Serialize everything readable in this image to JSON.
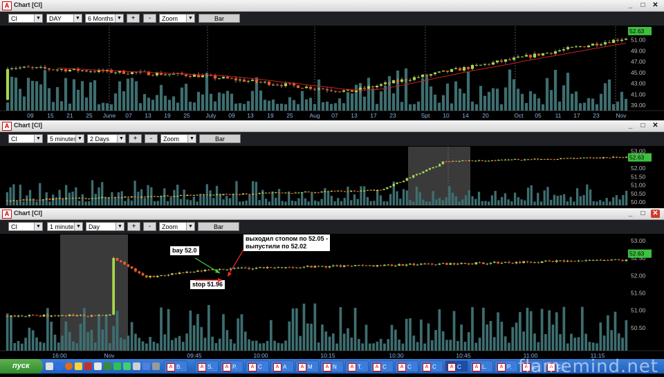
{
  "windows": [
    {
      "title": "Chart [CI]",
      "symbol": "CI",
      "period": "DAY",
      "range": "6 Months",
      "zoom": "Zoom",
      "plus": "+",
      "minus": "-",
      "bar": "Bar",
      "x_labels": [
        "09",
        "15",
        "21",
        "25",
        "June",
        "07",
        "13",
        "19",
        "25",
        "July",
        "09",
        "13",
        "19",
        "25",
        "Aug",
        "07",
        "13",
        "17",
        "23",
        "Spt",
        "10",
        "14",
        "20",
        "Oct",
        "05",
        "11",
        "17",
        "23",
        "Nov"
      ],
      "y_labels": [
        "51.00",
        "49.00",
        "47.00",
        "45.00",
        "43.00",
        "41.00",
        "39.00"
      ],
      "last_price": "52.63",
      "chart_data": {
        "type": "candlestick",
        "y_range": [
          38,
          53
        ],
        "start": 40.0,
        "end": 52.63,
        "ma_color": "#cc2020"
      }
    },
    {
      "title": "Chart [CI]",
      "symbol": "CI",
      "period": "5 minutes",
      "range": "2 Days",
      "zoom": "Zoom",
      "plus": "+",
      "minus": "-",
      "bar": "Bar",
      "y_labels": [
        "53.00",
        "52.50",
        "52.00",
        "51.50",
        "51.00",
        "50.50",
        "50.00"
      ],
      "last_price": "52.63",
      "chart_data": {
        "type": "candlestick",
        "y_range": [
          49.8,
          53.1
        ],
        "start": 50.1,
        "end": 52.63
      }
    },
    {
      "title": "Chart [CI]",
      "symbol": "CI",
      "period": "1 minute",
      "range": "Day",
      "zoom": "Zoom",
      "plus": "+",
      "minus": "-",
      "bar": "Bar",
      "x_labels": [
        "16:00",
        "Nov",
        "09:45",
        "10:00",
        "10:15",
        "10:30",
        "10:45",
        "11:00",
        "11:15"
      ],
      "y_labels": [
        "53.00",
        "52.50",
        "52.00",
        "51.50",
        "51.00",
        "50.50"
      ],
      "last_price": "52.63",
      "annotations": {
        "buy": "bay 52.0",
        "stop": "stop 51.96",
        "exit_line1": "выходил стопом по 52.05 -",
        "exit_line2": "выпустили по 52.02"
      },
      "chart_data": {
        "type": "candlestick",
        "y_range": [
          50.2,
          53.1
        ],
        "start": 50.85,
        "end": 52.45
      }
    }
  ],
  "taskbar": {
    "start": "пуск",
    "items": [
      "B.",
      "S.",
      "P.",
      "C",
      "A",
      "M",
      "N",
      "T.",
      "C",
      "C",
      "C",
      "C",
      "L.",
      "P.",
      "L.",
      "C"
    ],
    "watermark": "flamemind.net"
  }
}
